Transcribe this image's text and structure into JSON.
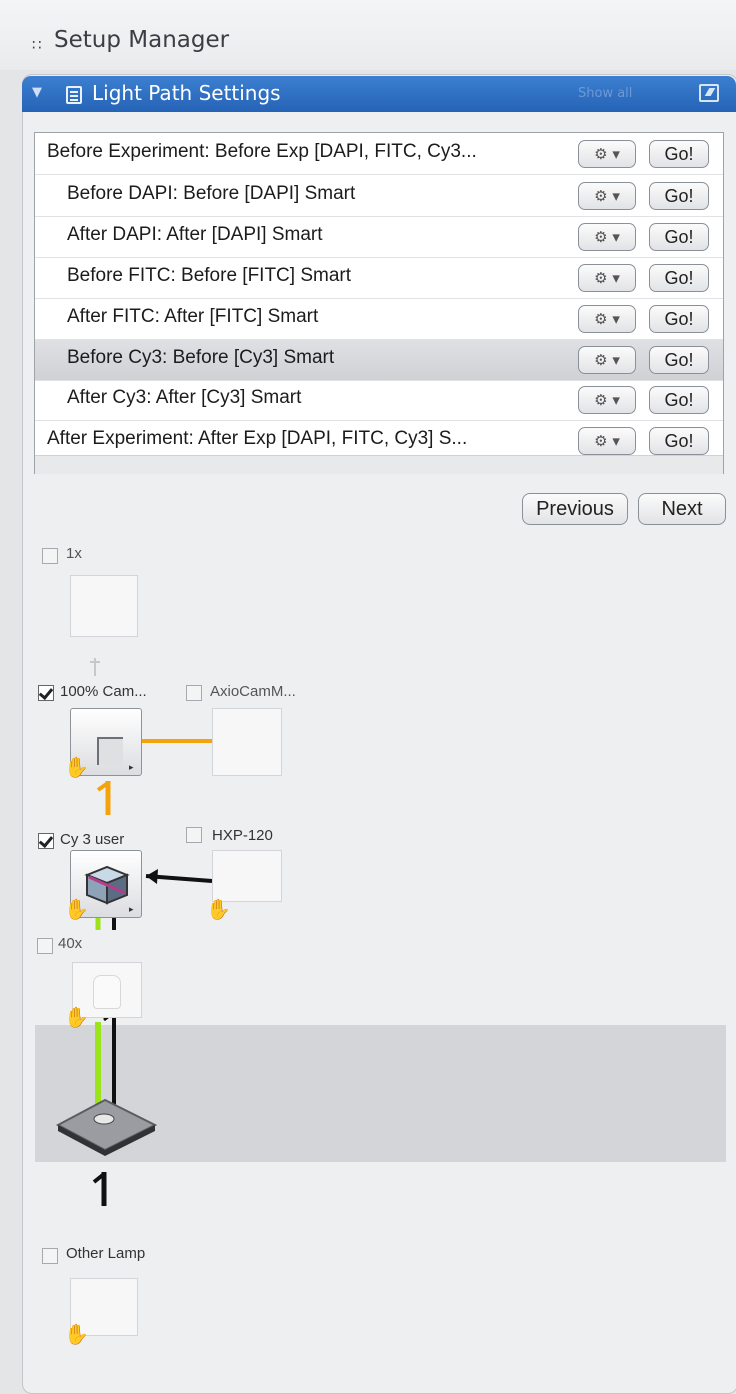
{
  "header": {
    "title": "Setup Manager",
    "grip_icon": "grip-icon"
  },
  "panel": {
    "title": "Light Path Settings",
    "show_all": "Show all",
    "collapse_icon": "collapse-arrow-icon",
    "panel_icon": "list-icon",
    "popout_icon": "popout-icon"
  },
  "settings_list": {
    "gear_label": "⚙ ▾",
    "go_label": "Go!",
    "items": [
      {
        "label": "Before Experiment:  Before Exp [DAPI, FITC, Cy3..."
      },
      {
        "label": "Before DAPI:  Before [DAPI] Smart"
      },
      {
        "label": "After DAPI:  After [DAPI] Smart"
      },
      {
        "label": "Before FITC:  Before [FITC] Smart"
      },
      {
        "label": "After FITC:  After [FITC] Smart"
      },
      {
        "label": "Before Cy3:  Before [Cy3] Smart"
      },
      {
        "label": "After Cy3:  After [Cy3] Smart"
      },
      {
        "label": "After Experiment:  After Exp [DAPI, FITC, Cy3] S..."
      }
    ]
  },
  "navigation": {
    "previous": "Previous",
    "next": "Next"
  },
  "light_path": {
    "components": [
      {
        "label": "1x",
        "checked": false
      },
      {
        "label": "100% Cam...",
        "checked": true
      },
      {
        "label": "AxioCamM...",
        "checked": false
      },
      {
        "label": "Cy 3 user",
        "checked": true
      },
      {
        "label": "HXP-120",
        "checked": false
      },
      {
        "label": "40x",
        "checked": false
      },
      {
        "label": "Other Lamp",
        "checked": false
      }
    ],
    "colors": {
      "camera_path": "#f5a30c",
      "excitation": "#9be31a",
      "emission": "#111111"
    }
  }
}
